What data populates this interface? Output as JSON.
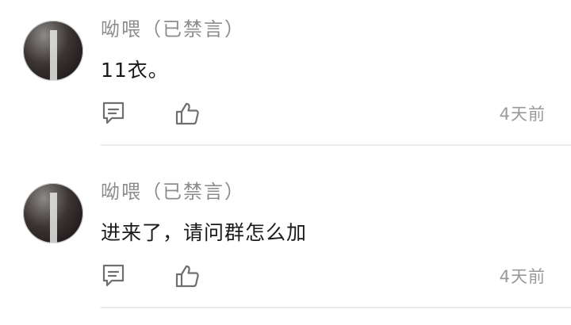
{
  "comments": [
    {
      "author": "呦喂（已禁言）",
      "text": "11衣。",
      "time": "4天前",
      "reply_icon": "comment-icon",
      "like_icon": "thumbs-up-icon"
    },
    {
      "author": "呦喂（已禁言）",
      "text": "进来了，请问群怎么加",
      "time": "4天前",
      "reply_icon": "comment-icon",
      "like_icon": "thumbs-up-icon"
    }
  ]
}
